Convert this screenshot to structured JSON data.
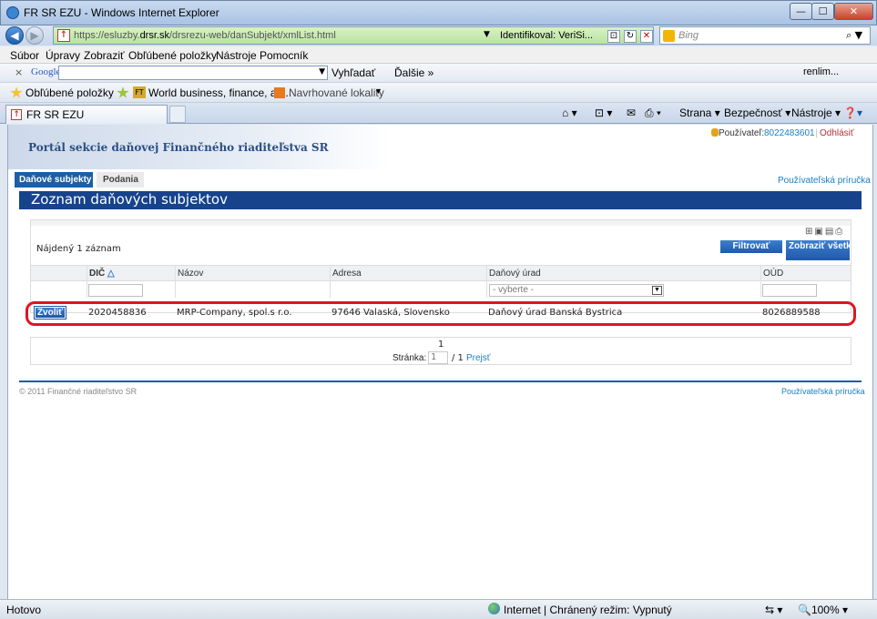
{
  "window": {
    "title": "FR SR EZU - Windows Internet Explorer",
    "min": "—",
    "max": "☐",
    "close": "✕"
  },
  "nav": {
    "url_prefix": "https://esluzby.",
    "url_domain": "drsr.sk",
    "url_path": "/drsrezu-web/danSubjekt/xmlList.html",
    "identified": "Identifikoval: VeriSi...",
    "search_placeholder": "Bing"
  },
  "menu": [
    "Súbor",
    "Úpravy",
    "Zobraziť",
    "Obľúbené položky",
    "Nástroje",
    "Pomocník"
  ],
  "google_bar": {
    "close": "×",
    "brand": "Google",
    "search": "Vyhľadať",
    "more": "Ďalšie »",
    "user": "renlim..."
  },
  "favorites": {
    "label": "Obľúbené položky",
    "item1": "World business, finance, an...",
    "item2": "Navrhované lokality"
  },
  "tab": {
    "title": "FR SR EZU"
  },
  "commands": {
    "page": "Strana",
    "security": "Bezpečnosť",
    "tools": "Nástroje"
  },
  "portal": {
    "title": "Portál sekcie daňovej Finančného riaditeľstva SR",
    "user_label": "Používateľ:",
    "user_id": "8022483601",
    "logout": "Odhlásiť",
    "tabs": [
      "Daňové subjekty",
      "Podania"
    ],
    "guide": "Používateľská príručka",
    "heading": "Zoznam daňových subjektov",
    "found": "Nájdený 1 záznam",
    "filter_btn": "Filtrovať",
    "show_all_btn": "Zobraziť všetko",
    "columns": [
      "DIČ",
      "Názov",
      "Adresa",
      "Daňový úrad",
      "OÚD"
    ],
    "office_select": "- vyberte -",
    "row": {
      "action": "Zvoliť",
      "dic": "2020458836",
      "name": "MRP-Company, spol.s r.o.",
      "address": "97646 Valaská, Slovensko",
      "office": "Daňový úrad Banská Bystrica",
      "oud": "8026889588"
    },
    "pager": {
      "page_number": "1",
      "page_label": "Stránka:",
      "page_input": "1",
      "of": "/ 1",
      "go": "Prejsť"
    },
    "copyright": "© 2011 Finančné riaditeľstvo SR"
  },
  "status": {
    "left": "Hotovo",
    "zone": "Internet | Chránený režim: Vypnutý",
    "zoom": "100%"
  }
}
